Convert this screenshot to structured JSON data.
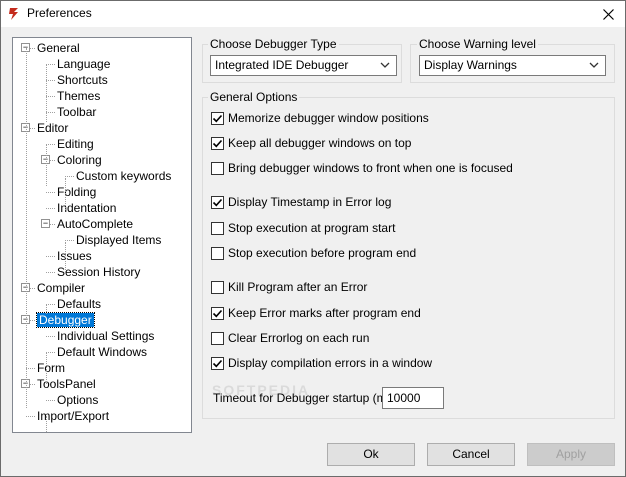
{
  "window": {
    "title": "Preferences",
    "close_glyph": "✕",
    "icon": "app-icon"
  },
  "tree": {
    "items": [
      {
        "label": "General",
        "level": 0,
        "expander": "−"
      },
      {
        "label": "Language",
        "level": 1
      },
      {
        "label": "Shortcuts",
        "level": 1
      },
      {
        "label": "Themes",
        "level": 1
      },
      {
        "label": "Toolbar",
        "level": 1
      },
      {
        "label": "Editor",
        "level": 0,
        "expander": "−"
      },
      {
        "label": "Editing",
        "level": 1
      },
      {
        "label": "Coloring",
        "level": 1,
        "expander": "−"
      },
      {
        "label": "Custom keywords",
        "level": 2
      },
      {
        "label": "Folding",
        "level": 1
      },
      {
        "label": "Indentation",
        "level": 1
      },
      {
        "label": "AutoComplete",
        "level": 1,
        "expander": "−"
      },
      {
        "label": "Displayed Items",
        "level": 2
      },
      {
        "label": "Issues",
        "level": 1
      },
      {
        "label": "Session History",
        "level": 1
      },
      {
        "label": "Compiler",
        "level": 0,
        "expander": "−"
      },
      {
        "label": "Defaults",
        "level": 1
      },
      {
        "label": "Debugger",
        "level": 0,
        "expander": "−",
        "selected": true
      },
      {
        "label": "Individual Settings",
        "level": 1
      },
      {
        "label": "Default Windows",
        "level": 1
      },
      {
        "label": "Form",
        "level": 0
      },
      {
        "label": "ToolsPanel",
        "level": 0,
        "expander": "−"
      },
      {
        "label": "Options",
        "level": 1
      },
      {
        "label": "Import/Export",
        "level": 0
      }
    ]
  },
  "debugger_type": {
    "label": "Choose Debugger Type",
    "value": "Integrated IDE Debugger"
  },
  "warning_level": {
    "label": "Choose Warning level",
    "value": "Display Warnings"
  },
  "general_options": {
    "label": "General Options",
    "checkboxes": [
      {
        "label": "Memorize debugger window positions",
        "checked": true
      },
      {
        "label": "Keep all debugger windows on top",
        "checked": true
      },
      {
        "label": "Bring debugger windows to front when one is focused",
        "checked": false
      },
      {
        "label": "Display Timestamp in Error log",
        "checked": true
      },
      {
        "label": "Stop execution at program start",
        "checked": false
      },
      {
        "label": "Stop execution before program end",
        "checked": false
      },
      {
        "label": "Kill Program after an Error",
        "checked": false
      },
      {
        "label": "Keep Error marks after program end",
        "checked": true
      },
      {
        "label": "Clear Errorlog on each run",
        "checked": false
      },
      {
        "label": "Display compilation errors in a window",
        "checked": true
      }
    ],
    "timeout_label": "Timeout for Debugger startup (ms):",
    "timeout_value": "10000"
  },
  "buttons": {
    "ok": "Ok",
    "cancel": "Cancel",
    "apply": "Apply"
  },
  "watermark": "SOFTPEDIA",
  "colors": {
    "selection": "#0078d7",
    "app_icon": "#c42b1c"
  }
}
